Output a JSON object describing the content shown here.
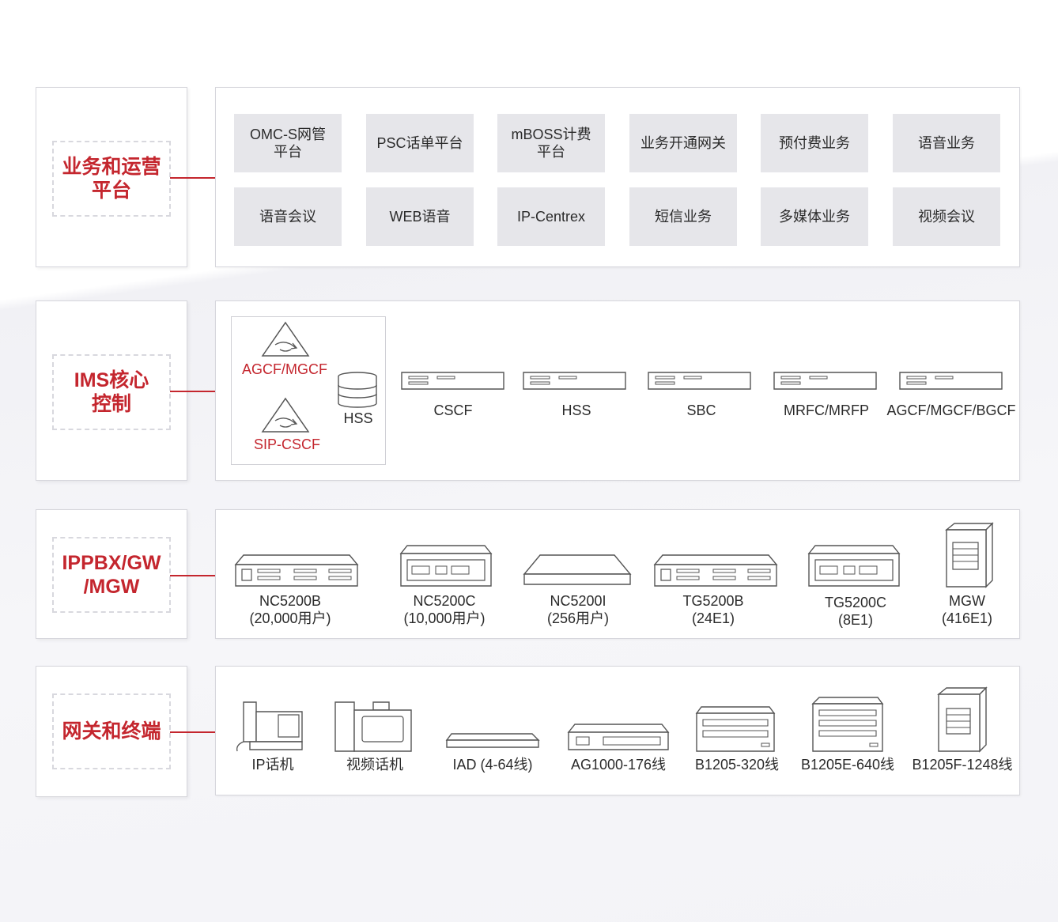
{
  "layers": [
    {
      "label": "业务和运营\n平台"
    },
    {
      "label": "IMS核心\n控制"
    },
    {
      "label": "IPPBX/GW\n/MGW"
    },
    {
      "label": "网关和终端"
    }
  ],
  "services": {
    "row1": [
      "OMC-S网管\n平台",
      "PSC话单平台",
      "mBOSS计费\n平台",
      "业务开通网关",
      "预付费业务",
      "语音业务"
    ],
    "row2": [
      "语音会议",
      "WEB语音",
      "IP-Centrex",
      "短信业务",
      "多媒体业务",
      "视频会议"
    ]
  },
  "ims": {
    "agcf": "AGCF/MGCF",
    "sipcscf": "SIP-CSCF",
    "hss_cluster": "HSS",
    "servers": [
      "CSCF",
      "HSS",
      "SBC",
      "MRFC/MRFP",
      "AGCF/MGCF/BGCF"
    ]
  },
  "ippbx": {
    "devices": [
      {
        "name": "NC5200B\n(20,000用户)",
        "icon": "rack-device-icon"
      },
      {
        "name": "NC5200C\n(10,000用户)",
        "icon": "box-device-icon"
      },
      {
        "name": "NC5200I\n(256用户)",
        "icon": "flat-device-icon"
      },
      {
        "name": "TG5200B\n(24E1)",
        "icon": "rack-device-icon"
      },
      {
        "name": "TG5200C\n(8E1)",
        "icon": "box-device-icon"
      },
      {
        "name": "MGW\n(416E1)",
        "icon": "cabinet-icon"
      }
    ]
  },
  "terminals": {
    "devices": [
      {
        "name": "IP话机",
        "icon": "ip-phone-icon"
      },
      {
        "name": "视频话机",
        "icon": "video-phone-icon"
      },
      {
        "name": "IAD (4-64线)",
        "icon": "iad-icon"
      },
      {
        "name": "AG1000-176线",
        "icon": "gateway-icon"
      },
      {
        "name": "B1205-320线",
        "icon": "chassis-icon"
      },
      {
        "name": "B1205E-640线",
        "icon": "chassis-icon"
      },
      {
        "name": "B1205F-1248线",
        "icon": "cabinet-icon"
      }
    ]
  },
  "colors": {
    "accent": "#c4262e",
    "service_bg": "#e6e6ea",
    "border": "#d6d6dc"
  }
}
